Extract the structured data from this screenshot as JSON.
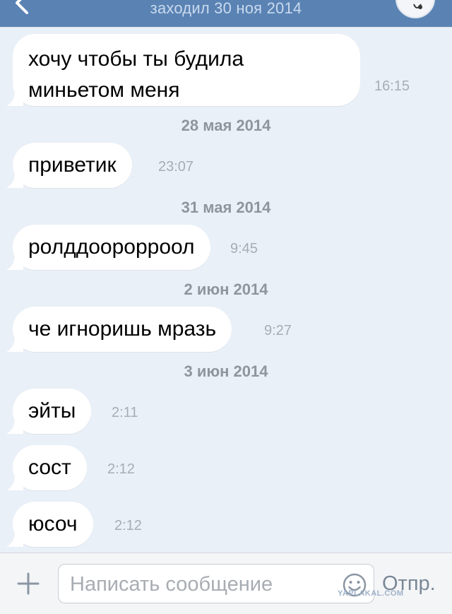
{
  "header": {
    "status": "заходил 30 ноя 2014"
  },
  "messages": [
    {
      "type": "message",
      "lines": [
        "хочу чтобы ты будила",
        "миньетом меня"
      ],
      "time": "16:15"
    },
    {
      "type": "date",
      "text": "28 мая 2014"
    },
    {
      "type": "message",
      "lines": [
        "приветик"
      ],
      "time": "23:07"
    },
    {
      "type": "date",
      "text": "31 мая 2014"
    },
    {
      "type": "message",
      "lines": [
        "ролддоорорроол"
      ],
      "time": "9:45"
    },
    {
      "type": "date",
      "text": "2 июн 2014"
    },
    {
      "type": "message",
      "lines": [
        "че игноришь мразь"
      ],
      "time": "9:27"
    },
    {
      "type": "date",
      "text": "3 июн 2014"
    },
    {
      "type": "message",
      "lines": [
        "эйты"
      ],
      "time": "2:11"
    },
    {
      "type": "message",
      "lines": [
        "сост"
      ],
      "time": "2:12"
    },
    {
      "type": "message",
      "lines": [
        "юсоч"
      ],
      "time": "2:12"
    }
  ],
  "composer": {
    "placeholder": "Написать сообщение",
    "send_label": "Отпр."
  },
  "watermark": "YAPLAKAL.COM",
  "colors": {
    "header": "#5a83b4",
    "background": "#eaf0f7",
    "bubble": "#ffffff",
    "time": "#a6adb5",
    "date": "#8e959d"
  },
  "icons": {
    "back": "chevron-left-icon",
    "attach": "plus-icon",
    "emoji": "smile-icon"
  }
}
